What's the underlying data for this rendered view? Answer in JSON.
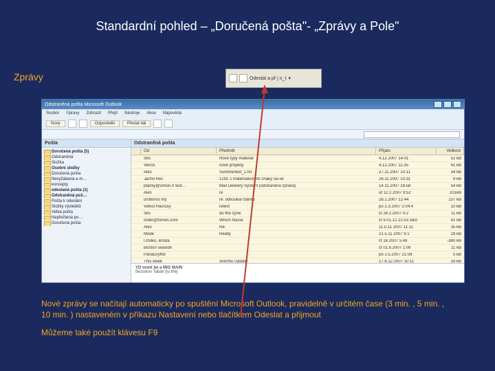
{
  "title": "Standardní pohled – „Doručená pošta\"- „Zprávy a Pole\"",
  "label_zpravy": "Zprávy",
  "snippet": {
    "send_label": "Odeslat a př j n_t",
    "dropdown": "▾"
  },
  "outlook": {
    "window_title": "Odstraněná pošta  Microsoft Outlook",
    "menu": [
      "Soubor",
      "Úpravy",
      "Zobrazit",
      "Přejít",
      "Nástroje",
      "Akce",
      "Nápověda"
    ],
    "toolbar": {
      "new": "Nový",
      "reply": "Odpovědět",
      "forward": "Předat dál"
    },
    "nav_header": "Pošta",
    "nav_items": [
      "Doručená pošta (5)",
      "Odstraněná",
      "Složka",
      "Osobní složky",
      "Doručená pošta",
      "Nevyžádaná e-m…",
      "koncepty",
      "odeslaná pošta (1)",
      "Odstraněná poš…",
      "Pošta k odeslání",
      "Složky výsledků",
      "Velká pošta",
      "Nepřečtená po…",
      "Doručená pošta"
    ],
    "content_header": "Odstraněná pošta",
    "columns": {
      "from": "Od",
      "subject": "Předmět",
      "received": "Přijato",
      "size": "Velikost"
    },
    "rows": [
      {
        "from": "Sks",
        "subject": "Nové typy materiál",
        "received": "4.12.2007 14:01",
        "size": "52 kB"
      },
      {
        "from": "Veiros",
        "subject": "nové projekty",
        "received": "4.12.2007 11:35",
        "size": "41 kB"
      },
      {
        "from": "Aleš",
        "subject": "Summertext_1.txt",
        "received": "27.11.2007 10:11",
        "size": "34 kB"
      },
      {
        "from": "Jarmil Rec",
        "subject": "1291 s matematickými znaky na-ve",
        "received": "26.11.2007 10:31",
        "size": "9 kB"
      },
      {
        "from": "ptáčky@simon.rl test…",
        "subject": "Mail Delivery System (odstraněná zpráva)",
        "received": "14.11.2007 16:58",
        "size": "54 kB"
      },
      {
        "from": "Aleš",
        "subject": "re",
        "received": "út 12.2.2007 9:52",
        "size": "201kB"
      },
      {
        "from": "uroboros my",
        "subject": "re: odkoukal článku",
        "received": "28.1.2007 12:44",
        "size": "137 kB"
      },
      {
        "from": "Velkoi Hacrosy",
        "subject": "retest",
        "received": "po 1.3.2007 2:04:4",
        "size": "10 kB"
      },
      {
        "from": "Sks",
        "subject": "do the cynic",
        "received": "čt 28.2.2007 0:2",
        "size": "11 kB"
      },
      {
        "from": "order@furries.com",
        "subject": "Which house",
        "received": "čt 9.01.12 21:03 odst",
        "size": "42 kB"
      },
      {
        "from": "Aleš",
        "subject": "Re:",
        "received": "11.5.11 2007 11:11",
        "size": "35 kB"
      },
      {
        "from": "Mode",
        "subject": "Really",
        "received": "21.5.11 2007 9:1",
        "size": "29 kB"
      },
      {
        "from": "l.chilko, Broda",
        "subject": "",
        "received": "čt 16.2007 5:49",
        "size": "-380 kB"
      },
      {
        "from": "Boston seaside",
        "subject": "",
        "received": "čt 01.6.2007 1:09",
        "size": "11 kB"
      },
      {
        "from": "PanáGryffor",
        "subject": "",
        "received": "po 1.5.2007 21:09",
        "size": "5 kB"
      },
      {
        "from": "This week",
        "subject": "sneShu Update",
        "received": "17.8.12.2007 10:11",
        "size": "33 kB"
      }
    ],
    "preview_title": "YD mont be a MIG MAIN",
    "preview_sender": "Beziskov Tabák [to the]"
  },
  "footer": {
    "p1": "Nové zprávy se načítají automaticky po spuštění Microsoft Outlook, pravidelně v určitém čase (3 min. , 5 min. , 10 min. ) nastaveném v příkazu Nastavení nebo tlačítkem Odeslat a přijmout",
    "p2": "Můžeme také použít klávesu F9"
  }
}
